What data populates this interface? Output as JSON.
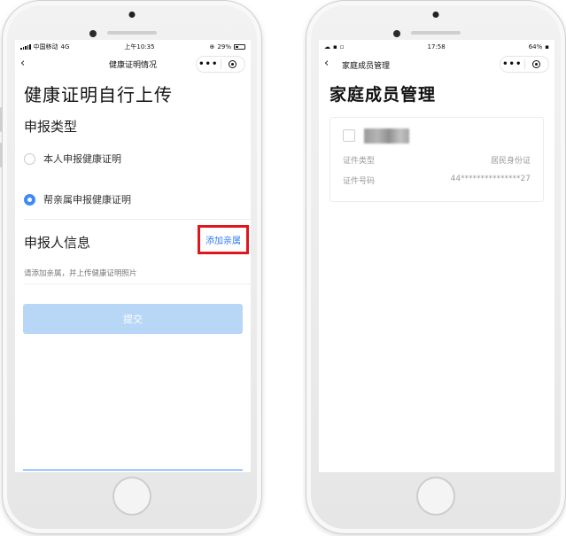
{
  "left_phone": {
    "status": {
      "carrier": "中国移动",
      "network": "4G",
      "time": "上午10:35",
      "battery": "29%"
    },
    "navbar": {
      "back_icon": "chevron-left-icon",
      "title": "健康证明情况",
      "more_icon": "more-dots-icon",
      "close_icon": "target-close-icon"
    },
    "page_title": "健康证明自行上传",
    "report_type": {
      "title": "申报类型",
      "options": [
        {
          "label": "本人申报健康证明",
          "checked": false
        },
        {
          "label": "帮亲属申报健康证明",
          "checked": true
        }
      ]
    },
    "applicant": {
      "title": "申报人信息",
      "add_label": "添加亲属",
      "hint": "请添加亲属，并上传健康证明照片"
    },
    "submit_label": "提交"
  },
  "right_phone": {
    "status": {
      "time": "17:58",
      "battery": "64%"
    },
    "navbar": {
      "back_icon": "chevron-left-icon",
      "title": "家庭成员管理",
      "more_icon": "more-dots-icon",
      "close_icon": "target-close-icon"
    },
    "page_title": "家庭成员管理",
    "member_card": {
      "id_type_label": "证件类型",
      "id_type_value": "居民身份证",
      "id_number_label": "证件号码",
      "id_number_value": "44***************27"
    }
  },
  "colors": {
    "accent_blue": "#3d8af7",
    "link_blue": "#2f7af3",
    "highlight_red": "#e0161d",
    "submit_disabled": "#b8d7f7"
  }
}
